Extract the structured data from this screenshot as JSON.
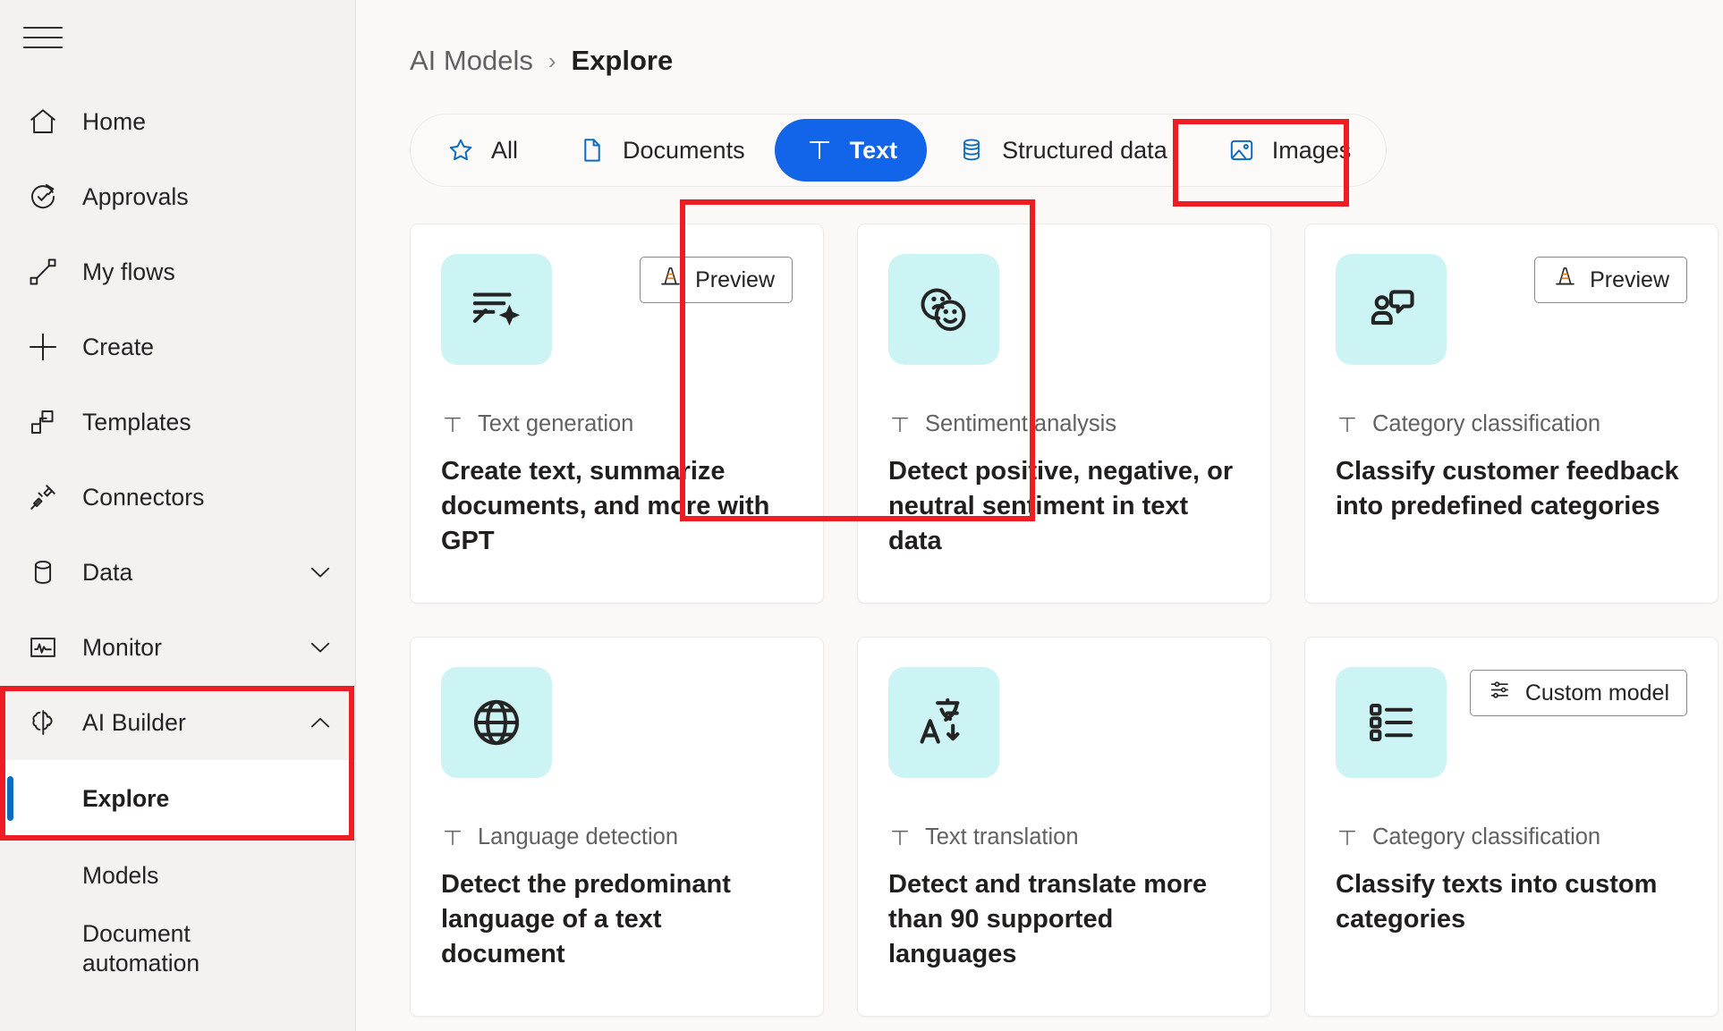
{
  "colors": {
    "accent": "#0f6cbd",
    "tab_active_bg": "#1264e8",
    "highlight_red": "#ee1d23",
    "tile_bg": "#cdf4f4",
    "sidebar_bg": "#f3f2f1"
  },
  "sidebar": {
    "menu_button": "Menu",
    "items": [
      {
        "label": "Home",
        "icon": "home-icon",
        "expandable": false
      },
      {
        "label": "Approvals",
        "icon": "approvals-icon",
        "expandable": false
      },
      {
        "label": "My flows",
        "icon": "flows-icon",
        "expandable": false
      },
      {
        "label": "Create",
        "icon": "plus-icon",
        "expandable": false
      },
      {
        "label": "Templates",
        "icon": "templates-icon",
        "expandable": false
      },
      {
        "label": "Connectors",
        "icon": "connectors-icon",
        "expandable": false
      },
      {
        "label": "Data",
        "icon": "database-icon",
        "expandable": true,
        "chevron": "chevron-down-icon"
      },
      {
        "label": "Monitor",
        "icon": "monitor-icon",
        "expandable": true,
        "chevron": "chevron-down-icon"
      },
      {
        "label": "AI Builder",
        "icon": "ai-builder-icon",
        "expandable": true,
        "chevron": "chevron-up-icon"
      }
    ],
    "sub_items": [
      {
        "label": "Explore",
        "selected": true
      },
      {
        "label": "Models",
        "selected": false
      },
      {
        "label": "Document automation",
        "selected": false
      }
    ]
  },
  "breadcrumb": {
    "root": "AI Models",
    "separator": "›",
    "current": "Explore"
  },
  "tabs": [
    {
      "label": "All",
      "icon": "star-icon",
      "active": false
    },
    {
      "label": "Documents",
      "icon": "document-icon",
      "active": false
    },
    {
      "label": "Text",
      "icon": "text-icon",
      "active": true
    },
    {
      "label": "Structured data",
      "icon": "database-stack-icon",
      "active": false
    },
    {
      "label": "Images",
      "icon": "image-icon",
      "active": false
    }
  ],
  "cards": [
    {
      "icon": "text-generation-icon",
      "badge": {
        "label": "Preview",
        "icon": "traffic-cone-icon"
      },
      "category": "Text generation",
      "category_icon": "text-icon",
      "title": "Create text, summarize documents, and more with GPT",
      "highlighted": true
    },
    {
      "icon": "sentiment-faces-icon",
      "badge": null,
      "category": "Sentiment analysis",
      "category_icon": "text-icon",
      "title": "Detect positive, negative, or neutral sentiment in text data",
      "highlighted": false
    },
    {
      "icon": "person-comment-icon",
      "badge": {
        "label": "Preview",
        "icon": "traffic-cone-icon"
      },
      "category": "Category classification",
      "category_icon": "text-icon",
      "title": "Classify customer feedback into predefined categories",
      "highlighted": false
    },
    {
      "icon": "globe-icon",
      "badge": null,
      "category": "Language detection",
      "category_icon": "text-icon",
      "title": "Detect the predominant language of a text document",
      "highlighted": false
    },
    {
      "icon": "translate-icon",
      "badge": null,
      "category": "Text translation",
      "category_icon": "text-icon",
      "title": "Detect and translate more than 90 supported languages",
      "highlighted": false
    },
    {
      "icon": "list-categories-icon",
      "badge": {
        "label": "Custom model",
        "icon": "sliders-icon"
      },
      "category": "Category classification",
      "category_icon": "text-icon",
      "title": "Classify texts into custom categories",
      "highlighted": false
    }
  ]
}
